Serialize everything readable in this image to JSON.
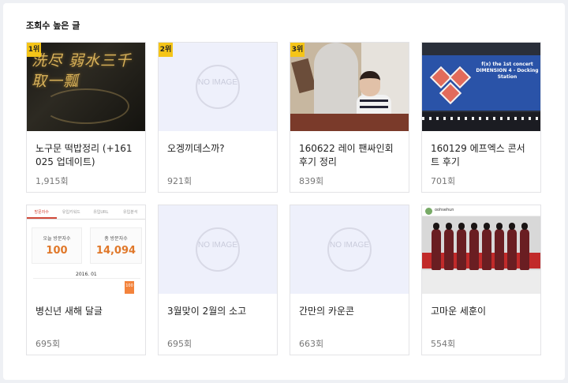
{
  "section": {
    "title": "조회수 높은 글"
  },
  "posts": [
    {
      "rank": "1위",
      "title": "노구문 떡밥정리 (+161025 업데이트)",
      "views": "1,915회",
      "thumb_text": "洗尽 弱水三千取一瓢"
    },
    {
      "rank": "2위",
      "title": "오겡끼데스까?",
      "views": "921회",
      "no_image": "NO IMAGE"
    },
    {
      "rank": "3위",
      "title": "160622 레이 팬싸인회 후기 정리",
      "views": "839회"
    },
    {
      "rank": "",
      "title": "160129 에프엑스 콘서트 후기",
      "views": "701회",
      "thumb_text": "f(x) the 1st concert DIMENSION 4 - Docking Station"
    },
    {
      "rank": "",
      "title": "병신년 새해 달글",
      "views": "695회",
      "app": {
        "tabs": [
          "방문자수",
          "유입키워드",
          "유입URL",
          "유입분석"
        ],
        "today_label": "오늘 방문자수",
        "today_value": "100",
        "total_label": "총 방문자수",
        "total_value": "14,094",
        "date": "2016. 01",
        "bar_value": "100"
      }
    },
    {
      "rank": "",
      "title": "3월맞이 2월의 소고",
      "views": "695회",
      "no_image": "NO IMAGE"
    },
    {
      "rank": "",
      "title": "간만의 카운콘",
      "views": "663회",
      "no_image": "NO IMAGE"
    },
    {
      "rank": "",
      "title": "고마운 세훈이",
      "views": "554회",
      "thumb_text": "oohsehun"
    }
  ],
  "colors": {
    "rank_badge": "#f5c518",
    "panel_bg": "#ffffff",
    "page_bg": "#eef0f4",
    "placeholder_bg": "#eef0fb"
  }
}
